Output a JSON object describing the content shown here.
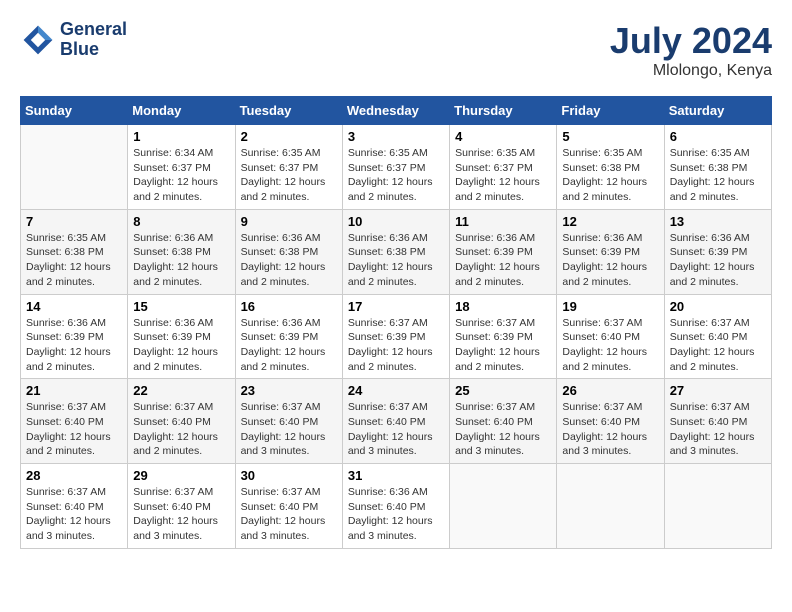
{
  "header": {
    "logo_line1": "General",
    "logo_line2": "Blue",
    "month": "July 2024",
    "location": "Mlolongo, Kenya"
  },
  "weekdays": [
    "Sunday",
    "Monday",
    "Tuesday",
    "Wednesday",
    "Thursday",
    "Friday",
    "Saturday"
  ],
  "weeks": [
    [
      {
        "day": "",
        "info": ""
      },
      {
        "day": "1",
        "info": "Sunrise: 6:34 AM\nSunset: 6:37 PM\nDaylight: 12 hours\nand 2 minutes."
      },
      {
        "day": "2",
        "info": "Sunrise: 6:35 AM\nSunset: 6:37 PM\nDaylight: 12 hours\nand 2 minutes."
      },
      {
        "day": "3",
        "info": "Sunrise: 6:35 AM\nSunset: 6:37 PM\nDaylight: 12 hours\nand 2 minutes."
      },
      {
        "day": "4",
        "info": "Sunrise: 6:35 AM\nSunset: 6:37 PM\nDaylight: 12 hours\nand 2 minutes."
      },
      {
        "day": "5",
        "info": "Sunrise: 6:35 AM\nSunset: 6:38 PM\nDaylight: 12 hours\nand 2 minutes."
      },
      {
        "day": "6",
        "info": "Sunrise: 6:35 AM\nSunset: 6:38 PM\nDaylight: 12 hours\nand 2 minutes."
      }
    ],
    [
      {
        "day": "7",
        "info": "Sunrise: 6:35 AM\nSunset: 6:38 PM\nDaylight: 12 hours\nand 2 minutes."
      },
      {
        "day": "8",
        "info": "Sunrise: 6:36 AM\nSunset: 6:38 PM\nDaylight: 12 hours\nand 2 minutes."
      },
      {
        "day": "9",
        "info": "Sunrise: 6:36 AM\nSunset: 6:38 PM\nDaylight: 12 hours\nand 2 minutes."
      },
      {
        "day": "10",
        "info": "Sunrise: 6:36 AM\nSunset: 6:38 PM\nDaylight: 12 hours\nand 2 minutes."
      },
      {
        "day": "11",
        "info": "Sunrise: 6:36 AM\nSunset: 6:39 PM\nDaylight: 12 hours\nand 2 minutes."
      },
      {
        "day": "12",
        "info": "Sunrise: 6:36 AM\nSunset: 6:39 PM\nDaylight: 12 hours\nand 2 minutes."
      },
      {
        "day": "13",
        "info": "Sunrise: 6:36 AM\nSunset: 6:39 PM\nDaylight: 12 hours\nand 2 minutes."
      }
    ],
    [
      {
        "day": "14",
        "info": "Sunrise: 6:36 AM\nSunset: 6:39 PM\nDaylight: 12 hours\nand 2 minutes."
      },
      {
        "day": "15",
        "info": "Sunrise: 6:36 AM\nSunset: 6:39 PM\nDaylight: 12 hours\nand 2 minutes."
      },
      {
        "day": "16",
        "info": "Sunrise: 6:36 AM\nSunset: 6:39 PM\nDaylight: 12 hours\nand 2 minutes."
      },
      {
        "day": "17",
        "info": "Sunrise: 6:37 AM\nSunset: 6:39 PM\nDaylight: 12 hours\nand 2 minutes."
      },
      {
        "day": "18",
        "info": "Sunrise: 6:37 AM\nSunset: 6:39 PM\nDaylight: 12 hours\nand 2 minutes."
      },
      {
        "day": "19",
        "info": "Sunrise: 6:37 AM\nSunset: 6:40 PM\nDaylight: 12 hours\nand 2 minutes."
      },
      {
        "day": "20",
        "info": "Sunrise: 6:37 AM\nSunset: 6:40 PM\nDaylight: 12 hours\nand 2 minutes."
      }
    ],
    [
      {
        "day": "21",
        "info": "Sunrise: 6:37 AM\nSunset: 6:40 PM\nDaylight: 12 hours\nand 2 minutes."
      },
      {
        "day": "22",
        "info": "Sunrise: 6:37 AM\nSunset: 6:40 PM\nDaylight: 12 hours\nand 2 minutes."
      },
      {
        "day": "23",
        "info": "Sunrise: 6:37 AM\nSunset: 6:40 PM\nDaylight: 12 hours\nand 3 minutes."
      },
      {
        "day": "24",
        "info": "Sunrise: 6:37 AM\nSunset: 6:40 PM\nDaylight: 12 hours\nand 3 minutes."
      },
      {
        "day": "25",
        "info": "Sunrise: 6:37 AM\nSunset: 6:40 PM\nDaylight: 12 hours\nand 3 minutes."
      },
      {
        "day": "26",
        "info": "Sunrise: 6:37 AM\nSunset: 6:40 PM\nDaylight: 12 hours\nand 3 minutes."
      },
      {
        "day": "27",
        "info": "Sunrise: 6:37 AM\nSunset: 6:40 PM\nDaylight: 12 hours\nand 3 minutes."
      }
    ],
    [
      {
        "day": "28",
        "info": "Sunrise: 6:37 AM\nSunset: 6:40 PM\nDaylight: 12 hours\nand 3 minutes."
      },
      {
        "day": "29",
        "info": "Sunrise: 6:37 AM\nSunset: 6:40 PM\nDaylight: 12 hours\nand 3 minutes."
      },
      {
        "day": "30",
        "info": "Sunrise: 6:37 AM\nSunset: 6:40 PM\nDaylight: 12 hours\nand 3 minutes."
      },
      {
        "day": "31",
        "info": "Sunrise: 6:36 AM\nSunset: 6:40 PM\nDaylight: 12 hours\nand 3 minutes."
      },
      {
        "day": "",
        "info": ""
      },
      {
        "day": "",
        "info": ""
      },
      {
        "day": "",
        "info": ""
      }
    ]
  ]
}
